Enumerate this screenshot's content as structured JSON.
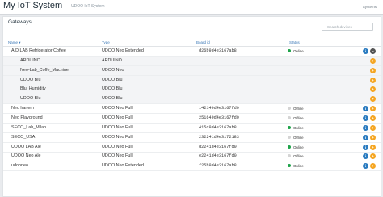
{
  "app": {
    "title": "My IoT System",
    "subtitle": "UDOO IoT System",
    "system_link": "Systems"
  },
  "panel": {
    "title": "Gateways",
    "search_placeholder": "Search devices"
  },
  "columns": {
    "name": "Name",
    "type": "Type",
    "board_id": "Board id",
    "status": "Status"
  },
  "colors": {
    "online": "#1fa34a",
    "offline": "#d4d4d4",
    "info": "#2a7bc0",
    "add": "#f5a623",
    "remove": "#555555"
  },
  "rows": [
    {
      "name": "AIDILAB Refrigerator Coffee",
      "type": "UDOO Neo Extended",
      "board_id": "d26b9d4e3167ab8",
      "status": "Online",
      "child": false,
      "actions": [
        "info",
        "remove"
      ]
    },
    {
      "name": "ARDUINO",
      "type": "ARDUINO",
      "board_id": "",
      "status": "",
      "child": true,
      "actions": [
        "add"
      ]
    },
    {
      "name": "Neo-Lab_Coffe_Machine",
      "type": "UDOO Neo",
      "board_id": "",
      "status": "",
      "child": true,
      "actions": [
        "add"
      ]
    },
    {
      "name": "UDOO Blu",
      "type": "UDOO Blu",
      "board_id": "",
      "status": "",
      "child": true,
      "actions": [
        "add"
      ]
    },
    {
      "name": "Blu_Humidity",
      "type": "UDOO Blu",
      "board_id": "",
      "status": "",
      "child": true,
      "actions": [
        "add"
      ]
    },
    {
      "name": "UDOO Blu",
      "type": "UDOO Blu",
      "board_id": "",
      "status": "",
      "child": true,
      "actions": [
        "add"
      ]
    },
    {
      "name": "Neo harlem",
      "type": "UDOO Neo Full",
      "board_id": "142149d4e3167fd0",
      "status": "Offline",
      "child": false,
      "actions": [
        "info",
        "add"
      ]
    },
    {
      "name": "Neo Playground",
      "type": "UDOO Neo Full",
      "board_id": "251649d4e3167fd0",
      "status": "Offline",
      "child": false,
      "actions": [
        "info",
        "add"
      ]
    },
    {
      "name": "SECO_Lab_Milan",
      "type": "UDOO Neo Full",
      "board_id": "415c9d4e3167ab8",
      "status": "Online",
      "child": false,
      "actions": [
        "info",
        "add"
      ]
    },
    {
      "name": "SECO_USA",
      "type": "UDOO Neo Full",
      "board_id": "232241d4e3172183",
      "status": "Offline",
      "child": false,
      "actions": [
        "info",
        "add"
      ]
    },
    {
      "name": "UDOO LAB Ale",
      "type": "UDOO Neo Full",
      "board_id": "d2241d4e3167fd0",
      "status": "Online",
      "child": false,
      "actions": [
        "info",
        "add"
      ]
    },
    {
      "name": "UDOO Neo Ale",
      "type": "UDOO Neo Full",
      "board_id": "e2241d4e3167fd0",
      "status": "Offline",
      "child": false,
      "actions": [
        "info",
        "add"
      ]
    },
    {
      "name": "udooneo",
      "type": "UDOO Neo Extended",
      "board_id": "f25b9d4e3167ab8",
      "status": "Online",
      "child": false,
      "actions": [
        "info",
        "add"
      ]
    }
  ]
}
